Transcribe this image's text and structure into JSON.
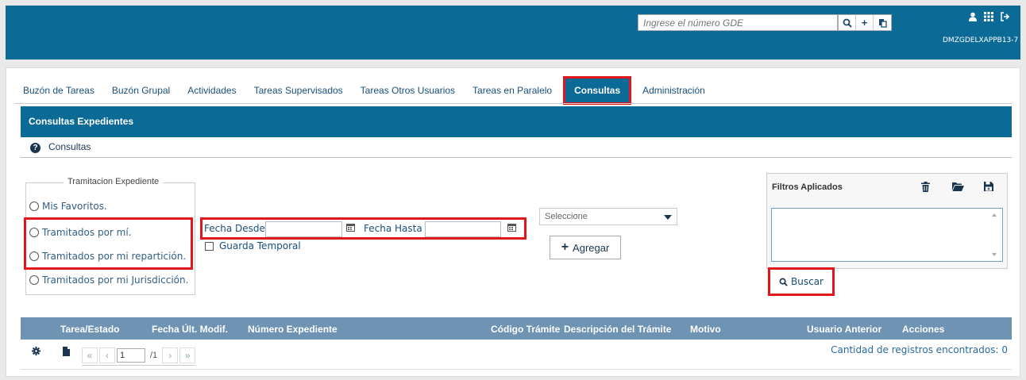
{
  "header": {
    "search_placeholder": "Ingrese el número GDE",
    "search_icon": "search-icon",
    "add_icon": "plus-icon",
    "copy_icon": "copy-icon",
    "user_icon": "user-icon",
    "grid_icon": "grid-icon",
    "logout_icon": "logout-icon",
    "username": "DMZGDELXAPPB13-7"
  },
  "tabs": [
    {
      "label": "Buzón de Tareas"
    },
    {
      "label": "Buzón Grupal"
    },
    {
      "label": "Actividades"
    },
    {
      "label": "Tareas Supervisados"
    },
    {
      "label": "Tareas Otros Usuarios"
    },
    {
      "label": "Tareas en Paralelo"
    },
    {
      "label": "Consultas",
      "active": true
    },
    {
      "label": "Administración"
    }
  ],
  "section": {
    "title": "Consultas Expedientes",
    "subtitle": "Consultas"
  },
  "tramitacion": {
    "legend": "Tramitacion Expediente",
    "options": [
      {
        "label": "Mis Favoritos."
      },
      {
        "label": "Tramitados por mí."
      },
      {
        "label": "Tramitados por mi repartición."
      },
      {
        "label": "Tramitados por mi Jurisdicción."
      }
    ]
  },
  "dates": {
    "desde_label": "Fecha Desde",
    "hasta_label": "Fecha Hasta",
    "desde_value": "",
    "hasta_value": ""
  },
  "guarda_temporal": {
    "label": "Guarda Temporal",
    "checked": false
  },
  "select": {
    "value": "Seleccione"
  },
  "agregar": {
    "label": "Agregar"
  },
  "filtros": {
    "title": "Filtros Aplicados"
  },
  "buscar": {
    "label": "Buscar"
  },
  "table": {
    "columns": [
      "Tarea/Estado",
      "Fecha Últ. Modif.",
      "Número Expediente",
      "Código Trámite",
      "Descripción del Trámite",
      "Motivo",
      "Usuario Anterior",
      "Acciones"
    ]
  },
  "pager": {
    "page": "1",
    "total": "/1",
    "count_text": "Cantidad de registros encontrados: 0"
  },
  "colors": {
    "primary": "#0c6a96",
    "table_header": "#6e93b3",
    "highlight": "#e3161c"
  }
}
